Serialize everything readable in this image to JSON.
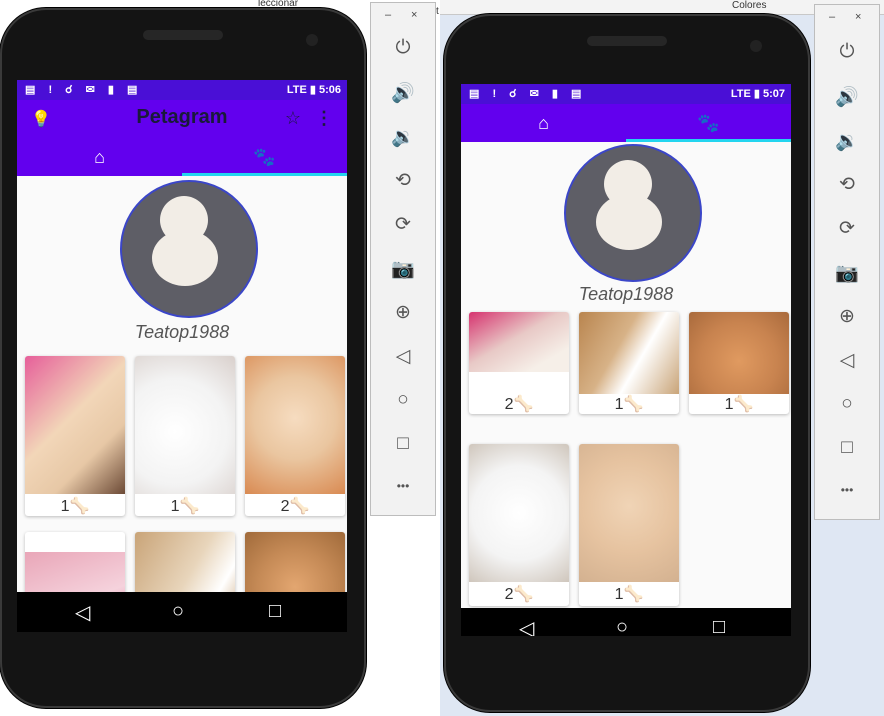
{
  "background": {
    "fragment_top": "leccionar",
    "fragment_t": "t",
    "fragment_right": "Colores"
  },
  "left_phone": {
    "status": {
      "icons": "▤ ! ☌ ✉ ▮ ▤",
      "right": "LTE ▮ 5:06"
    },
    "appbar": {
      "title": "Petagram",
      "bulb_icon": "lightbulb-icon",
      "star_icon": "star-icon",
      "menu_icon": "overflow-menu-icon"
    },
    "tabs": {
      "home_icon": "home-icon",
      "paw_icon": "paw-icon",
      "selected": "paw"
    },
    "profile_name": "Teatop1988",
    "cards": [
      {
        "count": "1",
        "bone": "🦴",
        "color": "#e7c8a6"
      },
      {
        "count": "1",
        "bone": "🦴",
        "color": "#f3f3f3"
      },
      {
        "count": "2",
        "bone": "🦴",
        "color": "#eac6a0"
      },
      {
        "count": "",
        "bone": "",
        "color": "#e9a6b8"
      },
      {
        "count": "",
        "bone": "",
        "color": "#c9a478"
      },
      {
        "count": "",
        "bone": "",
        "color": "#c58a56"
      }
    ]
  },
  "right_phone": {
    "status": {
      "icons": "▤ ! ☌ ✉ ▮ ▤",
      "right": "LTE ▮ 5:07"
    },
    "tabs": {
      "home_icon": "home-icon",
      "paw_icon": "paw-icon",
      "selected": "paw"
    },
    "profile_name": "Teatop1988",
    "cards": [
      {
        "count": "2",
        "bone": "🦴",
        "color": "#e8c9c6"
      },
      {
        "count": "1",
        "bone": "🦴",
        "color": "#c9a478"
      },
      {
        "count": "1",
        "bone": "🦴",
        "color": "#c8834f"
      },
      {
        "count": "2",
        "bone": "🦴",
        "color": "#f4f4f4"
      },
      {
        "count": "1",
        "bone": "🦴",
        "color": "#e6c3a0"
      }
    ]
  },
  "emulator": {
    "minimize": "–",
    "close": "×",
    "buttons": [
      "power-icon",
      "volume-up-icon",
      "volume-down-icon",
      "rotate-left-icon",
      "rotate-right-icon",
      "camera-icon",
      "zoom-in-icon",
      "back-icon",
      "home-icon",
      "overview-icon",
      "more-icon"
    ],
    "glyphs": [
      "⏻",
      "🔊",
      "🔉",
      "⟲",
      "⟳",
      "📷",
      "⊕",
      "◁",
      "○",
      "□",
      "•••"
    ]
  }
}
